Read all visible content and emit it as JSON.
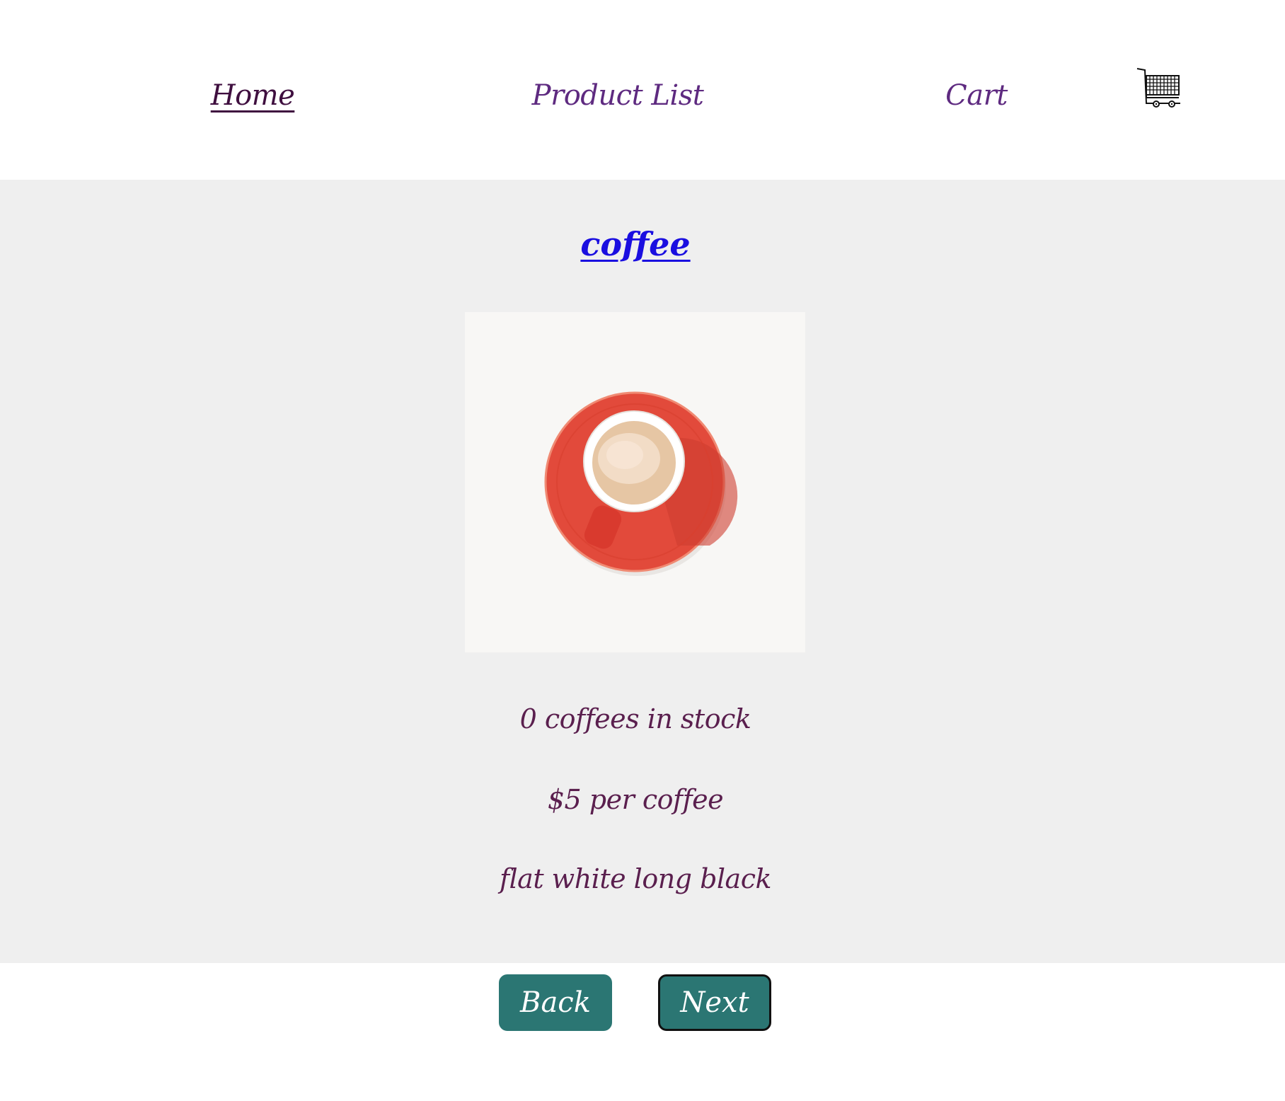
{
  "nav": {
    "home_label": "Home",
    "products_label": "Product List",
    "cart_label": "Cart",
    "cart_icon": "shopping-cart-icon"
  },
  "product": {
    "title": "coffee",
    "image": "red-espresso-cup-on-saucer",
    "stock_text": "0 coffees in stock",
    "price_text": "$5 per coffee",
    "description": "flat white long black"
  },
  "buttons": {
    "back_label": "Back",
    "next_label": "Next"
  },
  "colors": {
    "nav_link": "#5e2a80",
    "nav_active": "#3f0f3f",
    "title_link": "#1a0ee0",
    "info_text": "#5a1f4e",
    "main_bg": "#efefef",
    "button_bg": "#2b7673",
    "saucer": "#e2493a"
  }
}
